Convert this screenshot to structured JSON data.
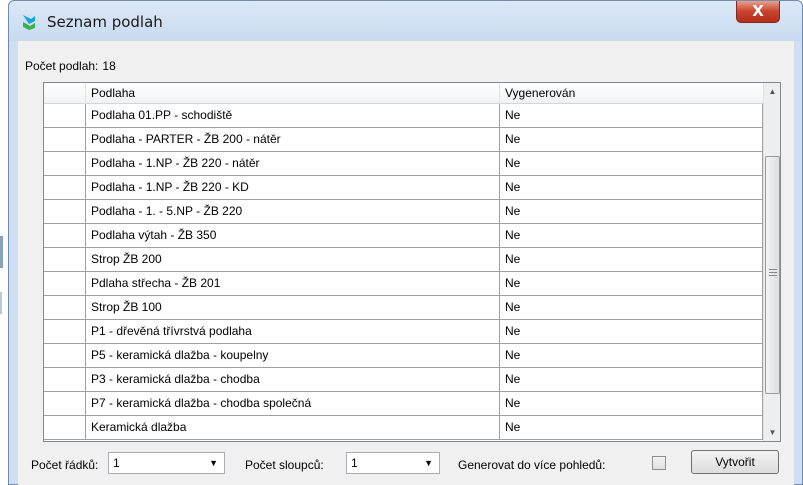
{
  "window": {
    "title": "Seznam podlah",
    "close_label": "X"
  },
  "summary": {
    "count_label": "Počet podlah:",
    "count_value": "18"
  },
  "table": {
    "columns": [
      "",
      "Podlaha",
      "Vygenerován"
    ],
    "rows": [
      {
        "name": "Podlaha 01.PP - schodiště",
        "generated": "Ne"
      },
      {
        "name": "Podlaha - PARTER - ŽB 200 - nátěr",
        "generated": "Ne"
      },
      {
        "name": "Podlaha - 1.NP - ŽB 220 - nátěr",
        "generated": "Ne"
      },
      {
        "name": "Podlaha - 1.NP - ŽB 220 - KD",
        "generated": "Ne"
      },
      {
        "name": "Podlaha - 1. - 5.NP - ŽB 220",
        "generated": "Ne"
      },
      {
        "name": "Podlaha výtah - ŽB 350",
        "generated": "Ne"
      },
      {
        "name": "Strop ŽB 200",
        "generated": "Ne"
      },
      {
        "name": "Pdlaha střecha - ŽB 201",
        "generated": "Ne"
      },
      {
        "name": "Strop ŽB 100",
        "generated": "Ne"
      },
      {
        "name": "P1 - dřevěná třívrstvá podlaha",
        "generated": "Ne"
      },
      {
        "name": "P5 - keramická dlažba - koupelny",
        "generated": "Ne"
      },
      {
        "name": "P3 - keramická dlažba - chodba",
        "generated": "Ne"
      },
      {
        "name": "P7 - keramická dlažba - chodba společná",
        "generated": "Ne"
      },
      {
        "name": "Keramická dlažba",
        "generated": "Ne"
      }
    ]
  },
  "footer": {
    "rows_label": "Počet řádků:",
    "rows_value": "1",
    "cols_label": "Počet sloupců:",
    "cols_value": "1",
    "multi_view_label": "Generovat do více pohledů:",
    "multi_view_checked": false,
    "create_label": "Vytvořit"
  },
  "icons": {
    "app": "app-logo-icon",
    "close": "close-icon",
    "scroll_up": "scroll-up-arrow-icon",
    "scroll_down": "scroll-down-arrow-icon",
    "dropdown": "chevron-down-icon"
  },
  "colors": {
    "title_bar": "#c8daf0",
    "close_button": "#c7432d",
    "dialog_bg": "#f0f0f0"
  }
}
